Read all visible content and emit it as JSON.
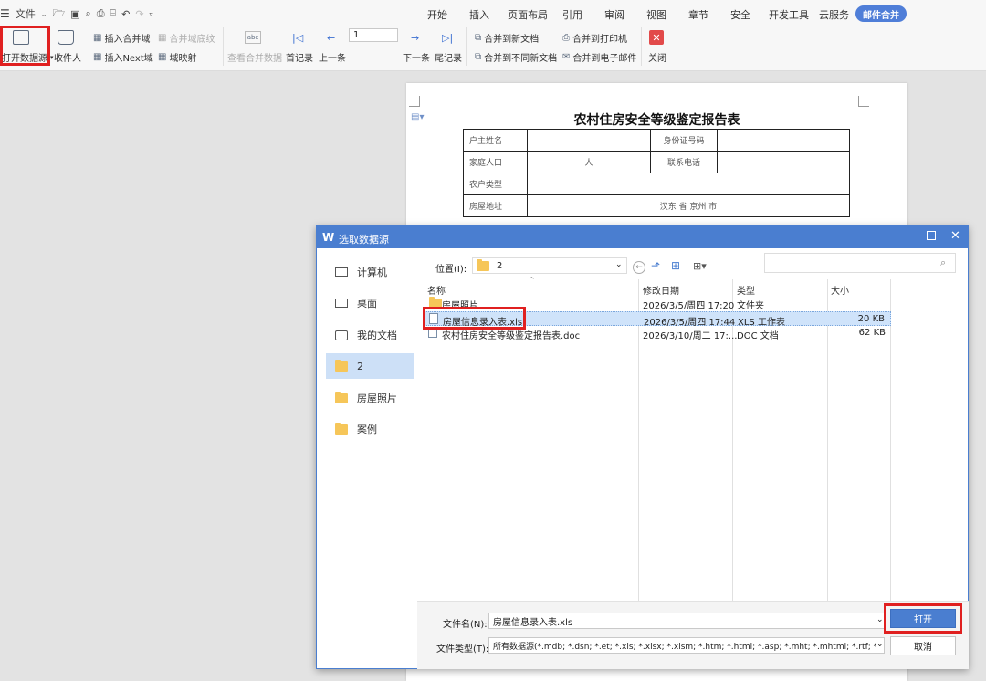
{
  "quick_access": {
    "menu_label": "文件"
  },
  "menu_tabs": [
    "开始",
    "插入",
    "页面布局",
    "引用",
    "审阅",
    "视图",
    "章节",
    "安全",
    "开发工具",
    "云服务"
  ],
  "active_tab": "邮件合并",
  "toolbar": {
    "open_source": "打开数据源",
    "recipients": "收件人",
    "insert_merge_field": "插入合并域",
    "highlight_fields": "合并域底纹",
    "insert_next": "插入Next域",
    "field_mapping": "域映射",
    "view_merged": "查看合并数据",
    "first": "首记录",
    "prev": "上一条",
    "record_number": "1",
    "next": "下一条",
    "last": "尾记录",
    "merge_new_doc": "合并到新文档",
    "merge_diff_docs": "合并到不同新文档",
    "merge_printer": "合并到打印机",
    "merge_email": "合并到电子邮件",
    "close": "关闭"
  },
  "document": {
    "title": "农村住房安全等级鉴定报告表",
    "cells": {
      "owner_name": "户主姓名",
      "id_number": "身份证号码",
      "family_size": "家庭人口",
      "person_unit": "人",
      "phone": "联系电话",
      "household_type": "农户类型",
      "address": "房屋地址",
      "address_value": "汉东 省 京州 市"
    }
  },
  "dialog": {
    "title": "选取数据源",
    "location_label": "位置(I):",
    "location_value": "2",
    "sidebar": [
      {
        "label": "计算机",
        "icon": "computer-icon"
      },
      {
        "label": "桌面",
        "icon": "desktop-icon"
      },
      {
        "label": "我的文档",
        "icon": "documents-icon"
      },
      {
        "label": "2",
        "icon": "folder-icon"
      },
      {
        "label": "房屋照片",
        "icon": "folder-icon"
      },
      {
        "label": "案例",
        "icon": "folder-icon"
      }
    ],
    "columns": {
      "name": "名称",
      "date": "修改日期",
      "type": "类型",
      "size": "大小"
    },
    "files": [
      {
        "name": "房屋照片",
        "date": "2026/3/5/周四 17:20",
        "type": "文件夹",
        "size": ""
      },
      {
        "name": "房屋信息录入表.xls",
        "date": "2026/3/5/周四 17:44",
        "type": "XLS 工作表",
        "size": "20 KB"
      },
      {
        "name": "农村住房安全等级鉴定报告表.doc",
        "date": "2026/3/10/周二 17:...",
        "type": "DOC 文档",
        "size": "62 KB"
      }
    ],
    "filename_label": "文件名(N):",
    "filename_value": "房屋信息录入表.xls",
    "filetype_label": "文件类型(T):",
    "filetype_value": "所有数据源(*.mdb; *.dsn; *.et; *.xls; *.xlsx; *.xlsm; *.htm; *.html; *.asp; *.mht; *.mhtml; *.rtf; *.docx; *.doc",
    "open_button": "打开",
    "cancel_button": "取消"
  }
}
